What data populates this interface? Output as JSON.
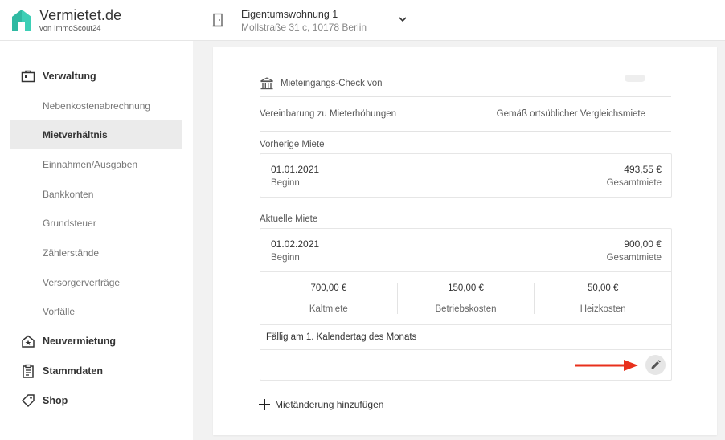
{
  "brand": {
    "name": "Vermietet.de",
    "subtitle": "von ImmoScout24",
    "color": "#3dcfb6"
  },
  "property": {
    "title": "Eigentumswohnung 1",
    "address": "Mollstraße 31 c, 10178 Berlin"
  },
  "sidebar": {
    "sections": [
      {
        "label": "Verwaltung",
        "icon": "briefcase-icon"
      },
      {
        "label": "Neuvermietung",
        "icon": "house-star-icon"
      },
      {
        "label": "Stammdaten",
        "icon": "clipboard-icon"
      },
      {
        "label": "Shop",
        "icon": "tag-icon"
      }
    ],
    "items": [
      {
        "label": "Nebenkostenabrechnung"
      },
      {
        "label": "Mietverhältnis",
        "active": true
      },
      {
        "label": "Einnahmen/Ausgaben"
      },
      {
        "label": "Bankkonten"
      },
      {
        "label": "Grundsteuer"
      },
      {
        "label": "Zählerstände"
      },
      {
        "label": "Versorgerverträge"
      },
      {
        "label": "Vorfälle"
      }
    ]
  },
  "main": {
    "check_label": "Mieteingangs-Check von",
    "agreement_label": "Vereinbarung zu Mieterhöhungen",
    "agreement_value": "Gemäß ortsüblicher Vergleichsmiete",
    "previous": {
      "section_label": "Vorherige Miete",
      "date": "01.01.2021",
      "date_label": "Beginn",
      "amount": "493,55 €",
      "amount_label": "Gesamtmiete"
    },
    "current": {
      "section_label": "Aktuelle Miete",
      "date": "01.02.2021",
      "date_label": "Beginn",
      "amount": "900,00 €",
      "amount_label": "Gesamtmiete",
      "breakdown": [
        {
          "value": "700,00 €",
          "label": "Kaltmiete"
        },
        {
          "value": "150,00 €",
          "label": "Betriebskosten"
        },
        {
          "value": "50,00 €",
          "label": "Heizkosten"
        }
      ],
      "due": "Fällig am 1. Kalendertag des Monats"
    },
    "add_change_label": "Mietänderung hinzufügen",
    "arrow_color": "#e8301c"
  }
}
